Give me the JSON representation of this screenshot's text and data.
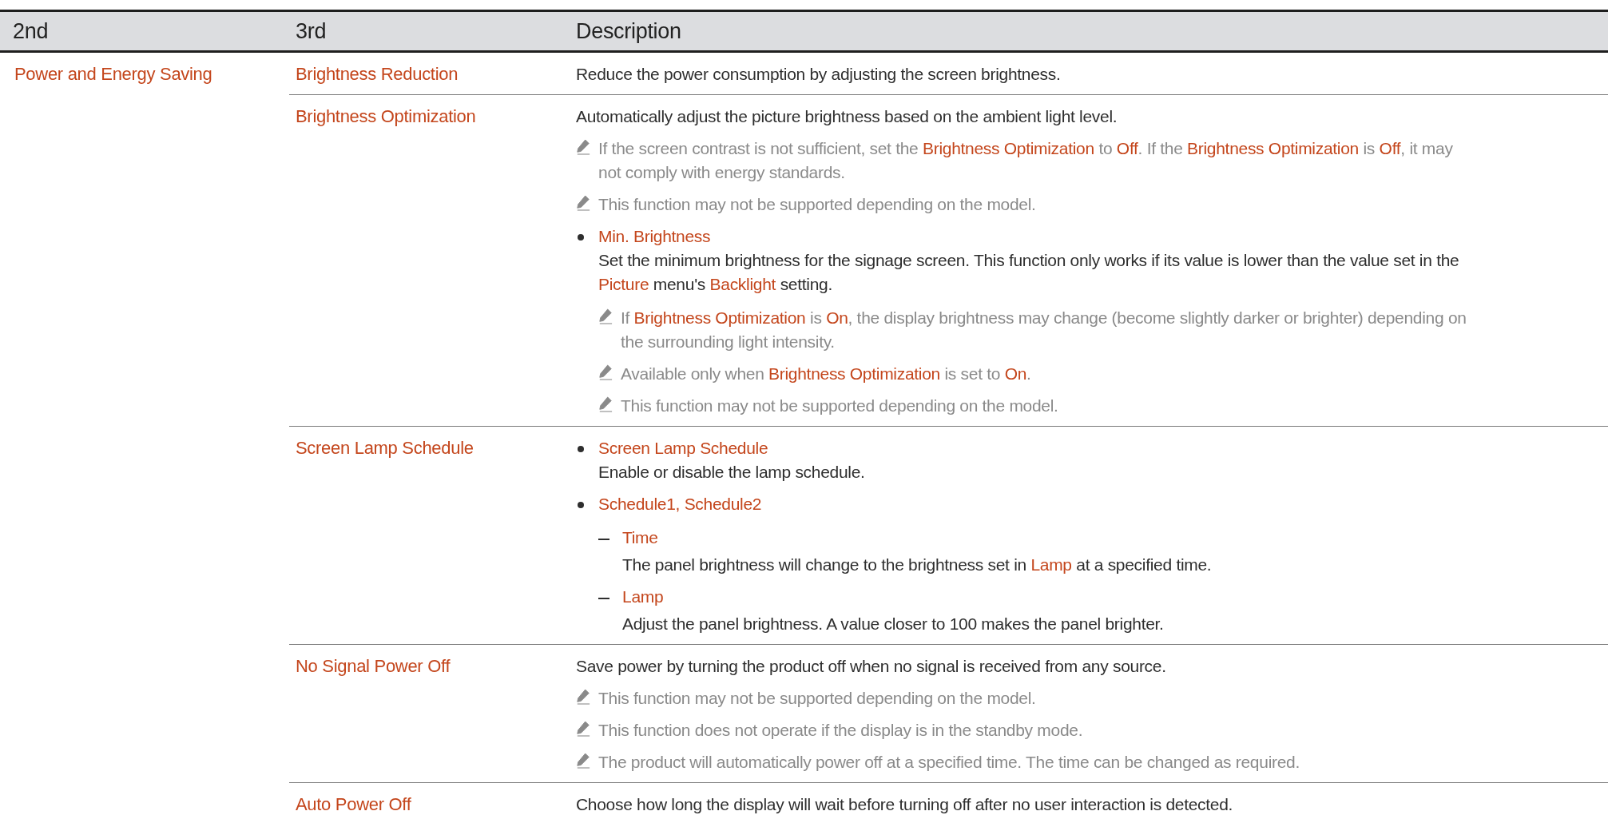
{
  "table": {
    "columns": [
      "2nd",
      "3rd",
      "Description"
    ],
    "groups": [
      {
        "name": "Power and Energy Saving",
        "items": [
          {
            "label": "Brightness Reduction",
            "blocks": [
              {
                "kind": "text",
                "text": "Reduce the power consumption by adjusting the screen brightness."
              }
            ]
          },
          {
            "label": "Brightness Optimization",
            "blocks": [
              {
                "kind": "text",
                "text": "Automatically adjust the picture brightness based on the ambient light level."
              },
              {
                "kind": "note",
                "text": "If the screen contrast is not sufficient, set the **Brightness Optimization** to **Off**. If the **Brightness Optimization** is **Off**, it may\nnot comply with energy standards."
              },
              {
                "kind": "note",
                "text": "This function may not be supported depending on the model."
              },
              {
                "kind": "bullet",
                "title": "Min. Brightness",
                "text": "Set the minimum brightness for the signage screen. This function only works if its value is lower than the value set in the\n**Picture** menu's **Backlight** setting.",
                "children": [
                  {
                    "kind": "note",
                    "text": "If **Brightness Optimization** is **On**, the display brightness may change (become slightly darker or brighter) depending on\nthe surrounding light intensity."
                  },
                  {
                    "kind": "note",
                    "text": "Available only when **Brightness Optimization** is set to **On**."
                  },
                  {
                    "kind": "note",
                    "text": "This function may not be supported depending on the model."
                  }
                ]
              }
            ]
          },
          {
            "label": "Screen Lamp Schedule",
            "blocks": [
              {
                "kind": "bullet",
                "title": "Screen Lamp Schedule",
                "text": "Enable or disable the lamp schedule."
              },
              {
                "kind": "bullet",
                "title": "**Schedule1**, **Schedule2**",
                "children": [
                  {
                    "kind": "dash",
                    "title": "Time",
                    "text": "The panel brightness will change to the brightness set in **Lamp** at a specified time."
                  },
                  {
                    "kind": "dash",
                    "title": "Lamp",
                    "text": "Adjust the panel brightness. A value closer to 100 makes the panel brighter."
                  }
                ]
              }
            ]
          },
          {
            "label": "No Signal Power Off",
            "blocks": [
              {
                "kind": "text",
                "text": "Save power by turning the product off when no signal is received from any source."
              },
              {
                "kind": "note",
                "text": "This function may not be supported depending on the model."
              },
              {
                "kind": "note",
                "text": "This function does not operate if the display is in the standby mode."
              },
              {
                "kind": "note",
                "text": "The product will automatically power off at a specified time. The time can be changed as required."
              }
            ]
          },
          {
            "label": "Auto Power Off",
            "blocks": [
              {
                "kind": "text",
                "text": "Choose how long the display will wait before turning off after no user interaction is detected."
              }
            ]
          }
        ]
      }
    ]
  }
}
